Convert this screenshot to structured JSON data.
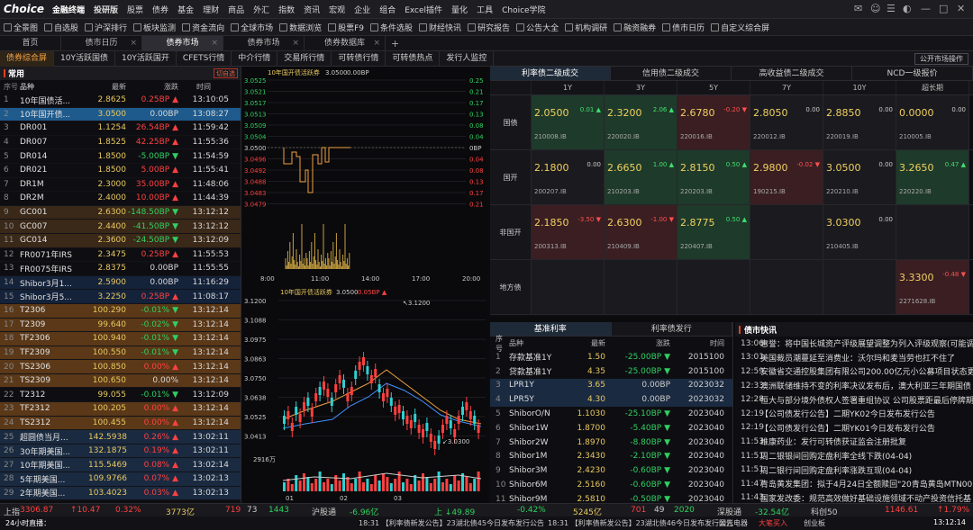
{
  "app": {
    "logo": "Choice",
    "logo_cn": "金融终端",
    "edition": "投研版",
    "menu": [
      "股票",
      "债券",
      "基金",
      "理财",
      "商品",
      "外汇",
      "指数",
      "资讯",
      "宏观",
      "企业",
      "组合",
      "Excel插件",
      "量化",
      "工具",
      "Choice学院"
    ]
  },
  "toolbar": [
    "全景图",
    "自选股",
    "沪深排行",
    "板块监测",
    "资金流向",
    "全球市场",
    "数据浏览",
    "股票F9",
    "条件选股",
    "财经快讯",
    "研究报告",
    "公告大全",
    "机构调研",
    "融资融券",
    "债市日历",
    "自定义综合屏"
  ],
  "page_tabs": [
    {
      "label": "首页",
      "active": false
    },
    {
      "label": "债市日历",
      "active": false
    },
    {
      "label": "债券市场",
      "active": true
    },
    {
      "label": "债券市场",
      "active": false
    },
    {
      "label": "债券数据库",
      "active": false
    }
  ],
  "sub_tabs": [
    "债券综合屏",
    "10Y活跃国债",
    "10Y活跃国开",
    "CFETS行情",
    "中介行情",
    "交易所行情",
    "可转债行情",
    "可转债热点",
    "发行人监控"
  ],
  "public_btn": "公开市场操作",
  "left": {
    "title": "常用",
    "cut_btn": "切自选",
    "cols": [
      "序号",
      "品种",
      "最新",
      "涨跌",
      "时间"
    ],
    "rows": [
      {
        "no": "1",
        "name": "10年国债活...",
        "last": "2.8625",
        "chg": "0.25BP ▲",
        "time": "13:10:05",
        "dir": "up",
        "bg": ""
      },
      {
        "no": "2",
        "name": "10年国开债...",
        "last": "3.0500",
        "chg": "0.00BP",
        "time": "13:08:27",
        "dir": "fl",
        "bg": "bg-sel"
      },
      {
        "no": "3",
        "name": "DR001",
        "last": "1.1254",
        "chg": "26.54BP ▲",
        "time": "11:59:42",
        "dir": "up",
        "bg": ""
      },
      {
        "no": "4",
        "name": "DR007",
        "last": "1.8525",
        "chg": "42.25BP ▲",
        "time": "11:55:36",
        "dir": "up",
        "bg": ""
      },
      {
        "no": "5",
        "name": "DR014",
        "last": "1.8500",
        "chg": "-5.00BP ▼",
        "time": "11:54:59",
        "dir": "dn",
        "bg": ""
      },
      {
        "no": "6",
        "name": "DR021",
        "last": "1.8500",
        "chg": "5.00BP ▲",
        "time": "11:55:41",
        "dir": "up",
        "bg": ""
      },
      {
        "no": "7",
        "name": "DR1M",
        "last": "2.3000",
        "chg": "35.00BP ▲",
        "time": "11:48:06",
        "dir": "up",
        "bg": ""
      },
      {
        "no": "8",
        "name": "DR2M",
        "last": "2.4000",
        "chg": "10.00BP ▲",
        "time": "11:44:39",
        "dir": "up",
        "bg": ""
      },
      {
        "no": "9",
        "name": "GC001",
        "last": "2.6300",
        "chg": "-148.50BP ▼",
        "time": "13:12:12",
        "dir": "dn",
        "bg": "bg-brn"
      },
      {
        "no": "10",
        "name": "GC007",
        "last": "2.4400",
        "chg": "-41.50BP ▼",
        "time": "13:12:12",
        "dir": "dn",
        "bg": "bg-brn"
      },
      {
        "no": "11",
        "name": "GC014",
        "last": "2.3600",
        "chg": "-24.50BP ▼",
        "time": "13:12:09",
        "dir": "dn",
        "bg": "bg-brn"
      },
      {
        "no": "12",
        "name": "FR0071年IRS",
        "last": "2.3475",
        "chg": "0.25BP ▲",
        "time": "11:55:53",
        "dir": "up",
        "bg": ""
      },
      {
        "no": "13",
        "name": "FR0075年IRS",
        "last": "2.8375",
        "chg": "0.00BP",
        "time": "11:55:55",
        "dir": "fl",
        "bg": ""
      },
      {
        "no": "14",
        "name": "Shibor3月1...",
        "last": "2.5900",
        "chg": "0.00BP",
        "time": "11:16:29",
        "dir": "fl",
        "bg": "bg-blu2"
      },
      {
        "no": "15",
        "name": "Shibor3月5...",
        "last": "3.2250",
        "chg": "0.25BP ▲",
        "time": "11:08:17",
        "dir": "up",
        "bg": "bg-blu2"
      },
      {
        "no": "16",
        "name": "T2306",
        "last": "100.290",
        "chg": "-0.01% ▼",
        "time": "13:12:14",
        "dir": "dn",
        "bg": "bg-brn2"
      },
      {
        "no": "17",
        "name": "T2309",
        "last": "99.640",
        "chg": "-0.02% ▼",
        "time": "13:12:14",
        "dir": "dn",
        "bg": "bg-brn2"
      },
      {
        "no": "18",
        "name": "TF2306",
        "last": "100.940",
        "chg": "-0.01% ▼",
        "time": "13:12:14",
        "dir": "dn",
        "bg": "bg-brn2"
      },
      {
        "no": "19",
        "name": "TF2309",
        "last": "100.550",
        "chg": "-0.01% ▼",
        "time": "13:12:14",
        "dir": "dn",
        "bg": "bg-brn2"
      },
      {
        "no": "20",
        "name": "TS2306",
        "last": "100.850",
        "chg": "0.00% ▲",
        "time": "13:12:14",
        "dir": "up",
        "bg": "bg-brn2"
      },
      {
        "no": "21",
        "name": "TS2309",
        "last": "100.650",
        "chg": "0.00%",
        "time": "13:12:14",
        "dir": "fl",
        "bg": "bg-brn2"
      },
      {
        "no": "22",
        "name": "T2312",
        "last": "99.055",
        "chg": "-0.01% ▼",
        "time": "13:12:09",
        "dir": "dn",
        "bg": ""
      },
      {
        "no": "23",
        "name": "TF2312",
        "last": "100.205",
        "chg": "0.00% ▲",
        "time": "13:12:14",
        "dir": "up",
        "bg": "bg-brn2"
      },
      {
        "no": "24",
        "name": "TS2312",
        "last": "100.455",
        "chg": "0.00% ▲",
        "time": "13:12:14",
        "dir": "up",
        "bg": "bg-brn2"
      },
      {
        "no": "25",
        "name": "超圆债当月...",
        "last": "142.5938",
        "chg": "0.26% ▲",
        "time": "13:02:11",
        "dir": "up",
        "bg": "bg-blu"
      },
      {
        "no": "26",
        "name": "30年期美国...",
        "last": "132.1875",
        "chg": "0.19% ▲",
        "time": "13:02:11",
        "dir": "up",
        "bg": "bg-blu"
      },
      {
        "no": "27",
        "name": "10年期美国...",
        "last": "115.5469",
        "chg": "0.08% ▲",
        "time": "13:02:14",
        "dir": "up",
        "bg": "bg-blu"
      },
      {
        "no": "28",
        "name": "5年期美国...",
        "last": "109.9766",
        "chg": "0.07% ▲",
        "time": "13:02:13",
        "dir": "up",
        "bg": "bg-blu"
      },
      {
        "no": "29",
        "name": "2年期美国...",
        "last": "103.4023",
        "chg": "0.03% ▲",
        "time": "13:02:13",
        "dir": "up",
        "bg": "bg-blu"
      }
    ]
  },
  "intraday": {
    "title": "10年国开债活跃券",
    "price": "3.0500",
    "chg": "0.00BP",
    "left_ticks": [
      "3.0525",
      "3.0521",
      "3.0517",
      "3.0513",
      "3.0509",
      "3.0504",
      "3.0500",
      "3.0496",
      "3.0492",
      "3.0488",
      "3.0483",
      "3.0479"
    ],
    "right_ticks": [
      "0.25",
      "0.21",
      "0.17",
      "0.13",
      "0.08",
      "0.04",
      "0BP",
      "0.04",
      "0.08",
      "0.13",
      "0.17",
      "0.21"
    ],
    "time_ticks": [
      "8:00",
      "11:00",
      "14:00",
      "17:00",
      "20:00"
    ]
  },
  "kline": {
    "title": "10年国开债活跃券",
    "price": "3.0500",
    "chg": "0.05BP ▲",
    "ticks": [
      "3.1200",
      "3.1088",
      "3.0975",
      "3.0863",
      "3.0750",
      "3.0638",
      "3.0525",
      "3.0413"
    ],
    "hi_label": "3.1200",
    "lo_label": "3.0300",
    "vol_label": "2916万",
    "month_ticks": [
      "01",
      "02",
      "03"
    ]
  },
  "rate_tabs": [
    "利率债二级成交",
    "信用债二级成交",
    "高收益债二级成交",
    "NCD一级报价"
  ],
  "grid_cols": [
    "1Y",
    "3Y",
    "5Y",
    "7Y",
    "10Y",
    "超长期"
  ],
  "grid_rows": [
    {
      "label": "国债",
      "cells": [
        {
          "v": "2.0500",
          "d": "0.01 ▲",
          "dd": "up",
          "code": "210008.IB",
          "bg": "gg"
        },
        {
          "v": "2.3200",
          "d": "2.06 ▲",
          "dd": "up",
          "code": "220020.IB",
          "bg": "gg"
        },
        {
          "v": "2.6780",
          "d": "-0.20 ▼",
          "dd": "down",
          "code": "220016.IB",
          "bg": "gr"
        },
        {
          "v": "2.8050",
          "d": "0.00",
          "dd": "flat",
          "code": "220012.IB",
          "bg": "gn"
        },
        {
          "v": "2.8850",
          "d": "0.00",
          "dd": "flat",
          "code": "220019.IB",
          "bg": "gn"
        },
        {
          "v": "0.0000",
          "d": "0.00",
          "dd": "flat",
          "code": "210005.IB",
          "bg": "gn"
        }
      ]
    },
    {
      "label": "国开",
      "cells": [
        {
          "v": "2.1800",
          "d": "0.00",
          "dd": "flat",
          "code": "200207.IB",
          "bg": "gn"
        },
        {
          "v": "2.6650",
          "d": "1.00 ▲",
          "dd": "up",
          "code": "210203.IB",
          "bg": "gg"
        },
        {
          "v": "2.8150",
          "d": "0.50 ▲",
          "dd": "up",
          "code": "220203.IB",
          "bg": "gg"
        },
        {
          "v": "2.9800",
          "d": "-0.02 ▼",
          "dd": "down",
          "code": "190215.IB",
          "bg": "gr"
        },
        {
          "v": "3.0500",
          "d": "0.00",
          "dd": "flat",
          "code": "220210.IB",
          "bg": "gn"
        },
        {
          "v": "3.2650",
          "d": "0.47 ▲",
          "dd": "up",
          "code": "220220.IB",
          "bg": "gg"
        }
      ]
    },
    {
      "label": "非国开",
      "cells": [
        {
          "v": "2.1850",
          "d": "-3.50 ▼",
          "dd": "down",
          "code": "200313.IB",
          "bg": "gr"
        },
        {
          "v": "2.6300",
          "d": "-1.00 ▼",
          "dd": "down",
          "code": "210409.IB",
          "bg": "gr"
        },
        {
          "v": "2.8775",
          "d": "0.50 ▲",
          "dd": "up",
          "code": "220407.IB",
          "bg": "gg"
        },
        {
          "v": "",
          "d": "",
          "dd": "flat",
          "code": "",
          "bg": "gn"
        },
        {
          "v": "3.0300",
          "d": "0.00",
          "dd": "flat",
          "code": "210405.IB",
          "bg": "gn"
        },
        {
          "v": "",
          "d": "",
          "dd": "flat",
          "code": "",
          "bg": "gn"
        }
      ]
    },
    {
      "label": "地方债",
      "cells": [
        {
          "v": "",
          "d": "",
          "dd": "flat",
          "code": "",
          "bg": "gn"
        },
        {
          "v": "",
          "d": "",
          "dd": "flat",
          "code": "",
          "bg": "gn"
        },
        {
          "v": "",
          "d": "",
          "dd": "flat",
          "code": "",
          "bg": "gn"
        },
        {
          "v": "",
          "d": "",
          "dd": "flat",
          "code": "",
          "bg": "gn"
        },
        {
          "v": "",
          "d": "",
          "dd": "flat",
          "code": "",
          "bg": "gn"
        },
        {
          "v": "3.3300",
          "d": "-0.48 ▼",
          "dd": "down",
          "code": "2271628.IB",
          "bg": "gr"
        }
      ]
    }
  ],
  "rates": {
    "tabs": [
      "基准利率",
      "利率债发行"
    ],
    "cols": [
      "序号",
      "品种",
      "最新",
      "涨跌",
      "时间"
    ],
    "rows": [
      {
        "no": "1",
        "name": "存款基准1Y",
        "last": "1.50",
        "chg": "-25.00BP ▼",
        "date": "2015100"
      },
      {
        "no": "2",
        "name": "贷款基准1Y",
        "last": "4.35",
        "chg": "-25.00BP ▼",
        "date": "2015100"
      },
      {
        "no": "3",
        "name": "LPR1Y",
        "last": "3.65",
        "chg": "0.00BP",
        "date": "2023032"
      },
      {
        "no": "4",
        "name": "LPR5Y",
        "last": "4.30",
        "chg": "0.00BP",
        "date": "2023032"
      },
      {
        "no": "5",
        "name": "ShiborO/N",
        "last": "1.1030",
        "chg": "-25.10BP ▼",
        "date": "2023040"
      },
      {
        "no": "6",
        "name": "Shibor1W",
        "last": "1.8700",
        "chg": "-5.40BP ▼",
        "date": "2023040"
      },
      {
        "no": "7",
        "name": "Shibor2W",
        "last": "1.8970",
        "chg": "-8.80BP ▼",
        "date": "2023040"
      },
      {
        "no": "8",
        "name": "Shibor1M",
        "last": "2.3430",
        "chg": "-2.10BP ▼",
        "date": "2023040"
      },
      {
        "no": "9",
        "name": "Shibor3M",
        "last": "2.4230",
        "chg": "-0.60BP ▼",
        "date": "2023040"
      },
      {
        "no": "10",
        "name": "Shibor6M",
        "last": "2.5160",
        "chg": "-0.60BP ▼",
        "date": "2023040"
      },
      {
        "no": "11",
        "name": "Shibor9M",
        "last": "2.5810",
        "chg": "-0.50BP ▼",
        "date": "2023040"
      }
    ]
  },
  "news": {
    "title": "债市快讯",
    "items": [
      {
        "t": "13:06",
        "x": "惠誉：将中国长城资产评级展望调整为列入评级观察(可能调"
      },
      {
        "t": "13:01",
        "x": "美国裁员潮蔓延至消费业：沃尔玛和麦当劳也扛不住了"
      },
      {
        "t": "12:59",
        "x": "安徽省交通控股集团有限公司200.00亿元小公募项目状态更"
      },
      {
        "t": "12:33",
        "x": "澳洲联储维持不变的利率决议发布后，澳大利亚三年期国债"
      },
      {
        "t": "12:28",
        "x": "恒大与部分境外债权人签署重组协议 公司股票距最后停牌期"
      },
      {
        "t": "12:19",
        "x": "【公司债发行公告】二期YK02今日发布发行公告"
      },
      {
        "t": "12:19",
        "x": "【公司债发行公告】二期YK01今日发布发行公告"
      },
      {
        "t": "11:53",
        "x": "维康药业：发行可转债获证监会注册批复"
      },
      {
        "t": "11:51",
        "x": "周二银银间回购定盘利率全线下跌(04-04)"
      },
      {
        "t": "11:51",
        "x": "周二银行间回购定盘利率涨跌互现(04-04)"
      },
      {
        "t": "11:47",
        "x": "青岛黄发集团：拟于4月24日全额赎回\"20青岛黄岛MTN00"
      },
      {
        "t": "11:43",
        "x": "国家发改委：规范高效做好基础设施领域不动产投资信托基"
      },
      {
        "t": "11:38",
        "x": "国家发改委印发《关于规范高效做好基础设施领域不动产投"
      }
    ]
  },
  "status": {
    "sh": "上指",
    "sh_v": "3306.87",
    "sh_c": "↑10.47",
    "sh_p": "0.32%",
    "sh_amt": "3773亿",
    "sh_n1": "719",
    "sh_n2": "73",
    "sh_n3": "1443",
    "hgt": "沪股通",
    "hgt_v": "-6.96亿",
    "sz": "上 ↓49.89",
    "sz_p": "-0.42%",
    "sz_amt": "5245亿",
    "sz_n1": "701",
    "sz_n2": "49",
    "sz_n3": "2020",
    "sgt": "深股通",
    "sgt_v": "-32.54亿",
    "hs": "科创50",
    "hs_v": "1146.61",
    "hs_p": "↑1.79%"
  },
  "bottom": {
    "hot": "24小时直播：",
    "n1": "18:31 【利率债新发公告】23湖北债45今日发布发行公告",
    "n2": "18:31 【利率债新发公告】23湖北债46今日发布发行公告",
    "a": "国光电器",
    "b": "大笔买入",
    "c": "创业板",
    "time": "13:12:14"
  }
}
